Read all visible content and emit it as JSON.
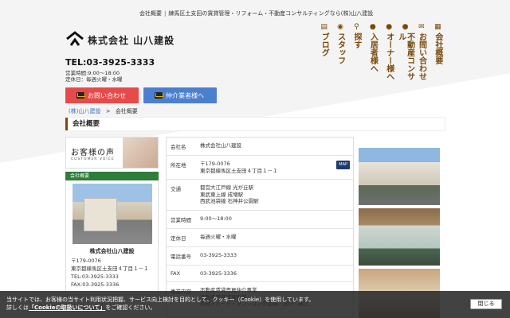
{
  "header": {
    "tagline_items": [
      "会社概要",
      "練馬区土支田の賃貸管理・リフォーム・不動産コンサルティングなら(株)山八建設"
    ],
    "brand": "株式会社 山八建設",
    "tel": "TEL:03-3925-3333",
    "hours": "営業時間:9:00～18:00",
    "holidays": "定休日：毎週火曜・水曜",
    "contact_button": "お問い合わせ",
    "agent_button": "仲介業者様へ"
  },
  "nav": {
    "items": [
      {
        "label": "会社概要",
        "icon": "building-icon"
      },
      {
        "label": "お問い合わせ",
        "icon": "mail-icon"
      },
      {
        "label": "不動産コンサル",
        "icon": "person-icon"
      },
      {
        "label": "オーナー様へ",
        "icon": "person-icon"
      },
      {
        "label": "入居者様へ",
        "icon": "person-icon"
      },
      {
        "label": "探す",
        "icon": "search-icon"
      },
      {
        "label": "スタッフ",
        "icon": "staff-icon"
      },
      {
        "label": "ブログ",
        "icon": "blog-icon"
      }
    ]
  },
  "breadcrumb": {
    "home": "(株)山八建設",
    "separator": ">",
    "current": "会社概要"
  },
  "page_title": "会社概要",
  "sidebar": {
    "voice_title": "お客様の声",
    "voice_sub": "CUSTOMER VOICE",
    "section_head": "会社概要",
    "company_name": "株式会社山八建設",
    "lines": [
      "〒179-0076",
      "東京都練馬区土支田４丁目１－１",
      "TEL:03-3925-3333",
      "FAX:03-3925-3336"
    ]
  },
  "table": {
    "map_badge": "MAP",
    "rows": [
      {
        "key": "会社名",
        "value": "株式会社山八建設"
      },
      {
        "key": "所在地",
        "value": "〒179-0076\n東京都練馬区土支田４丁目１－１"
      },
      {
        "key": "交通",
        "value": "都営大江戸線 光が丘駅\n東武東上線 成増駅\n西武池袋線 石神井公園駅"
      },
      {
        "key": "営業時間",
        "value": "9:00～18:00"
      },
      {
        "key": "定休日",
        "value": "毎週火曜・水曜"
      },
      {
        "key": "電話番号",
        "value": "03-3925-3333"
      },
      {
        "key": "FAX",
        "value": "03-3925-3336"
      },
      {
        "key": "事業内容",
        "value": "不動産賃貸売買仲介事業\n不動産賃貸管理事業\n賃貸アパート・マンションの企画・設計・施工"
      }
    ]
  },
  "cookie": {
    "line1": "当サイトでは、お客様の当サイト利用状況把握、サービス向上検討を目的として、クッキー（Cookie）を使用しています。",
    "line2_prefix": "詳しくは",
    "line2_link": "「Cookieの取扱いについて」",
    "line2_suffix": "をご確認ください。",
    "close": "閉じる"
  },
  "colors": {
    "accent_brown": "#7a4a0c",
    "contact_red": "#e74a4a",
    "agent_blue": "#4d7fcf",
    "side_green": "#2e7d3a"
  }
}
